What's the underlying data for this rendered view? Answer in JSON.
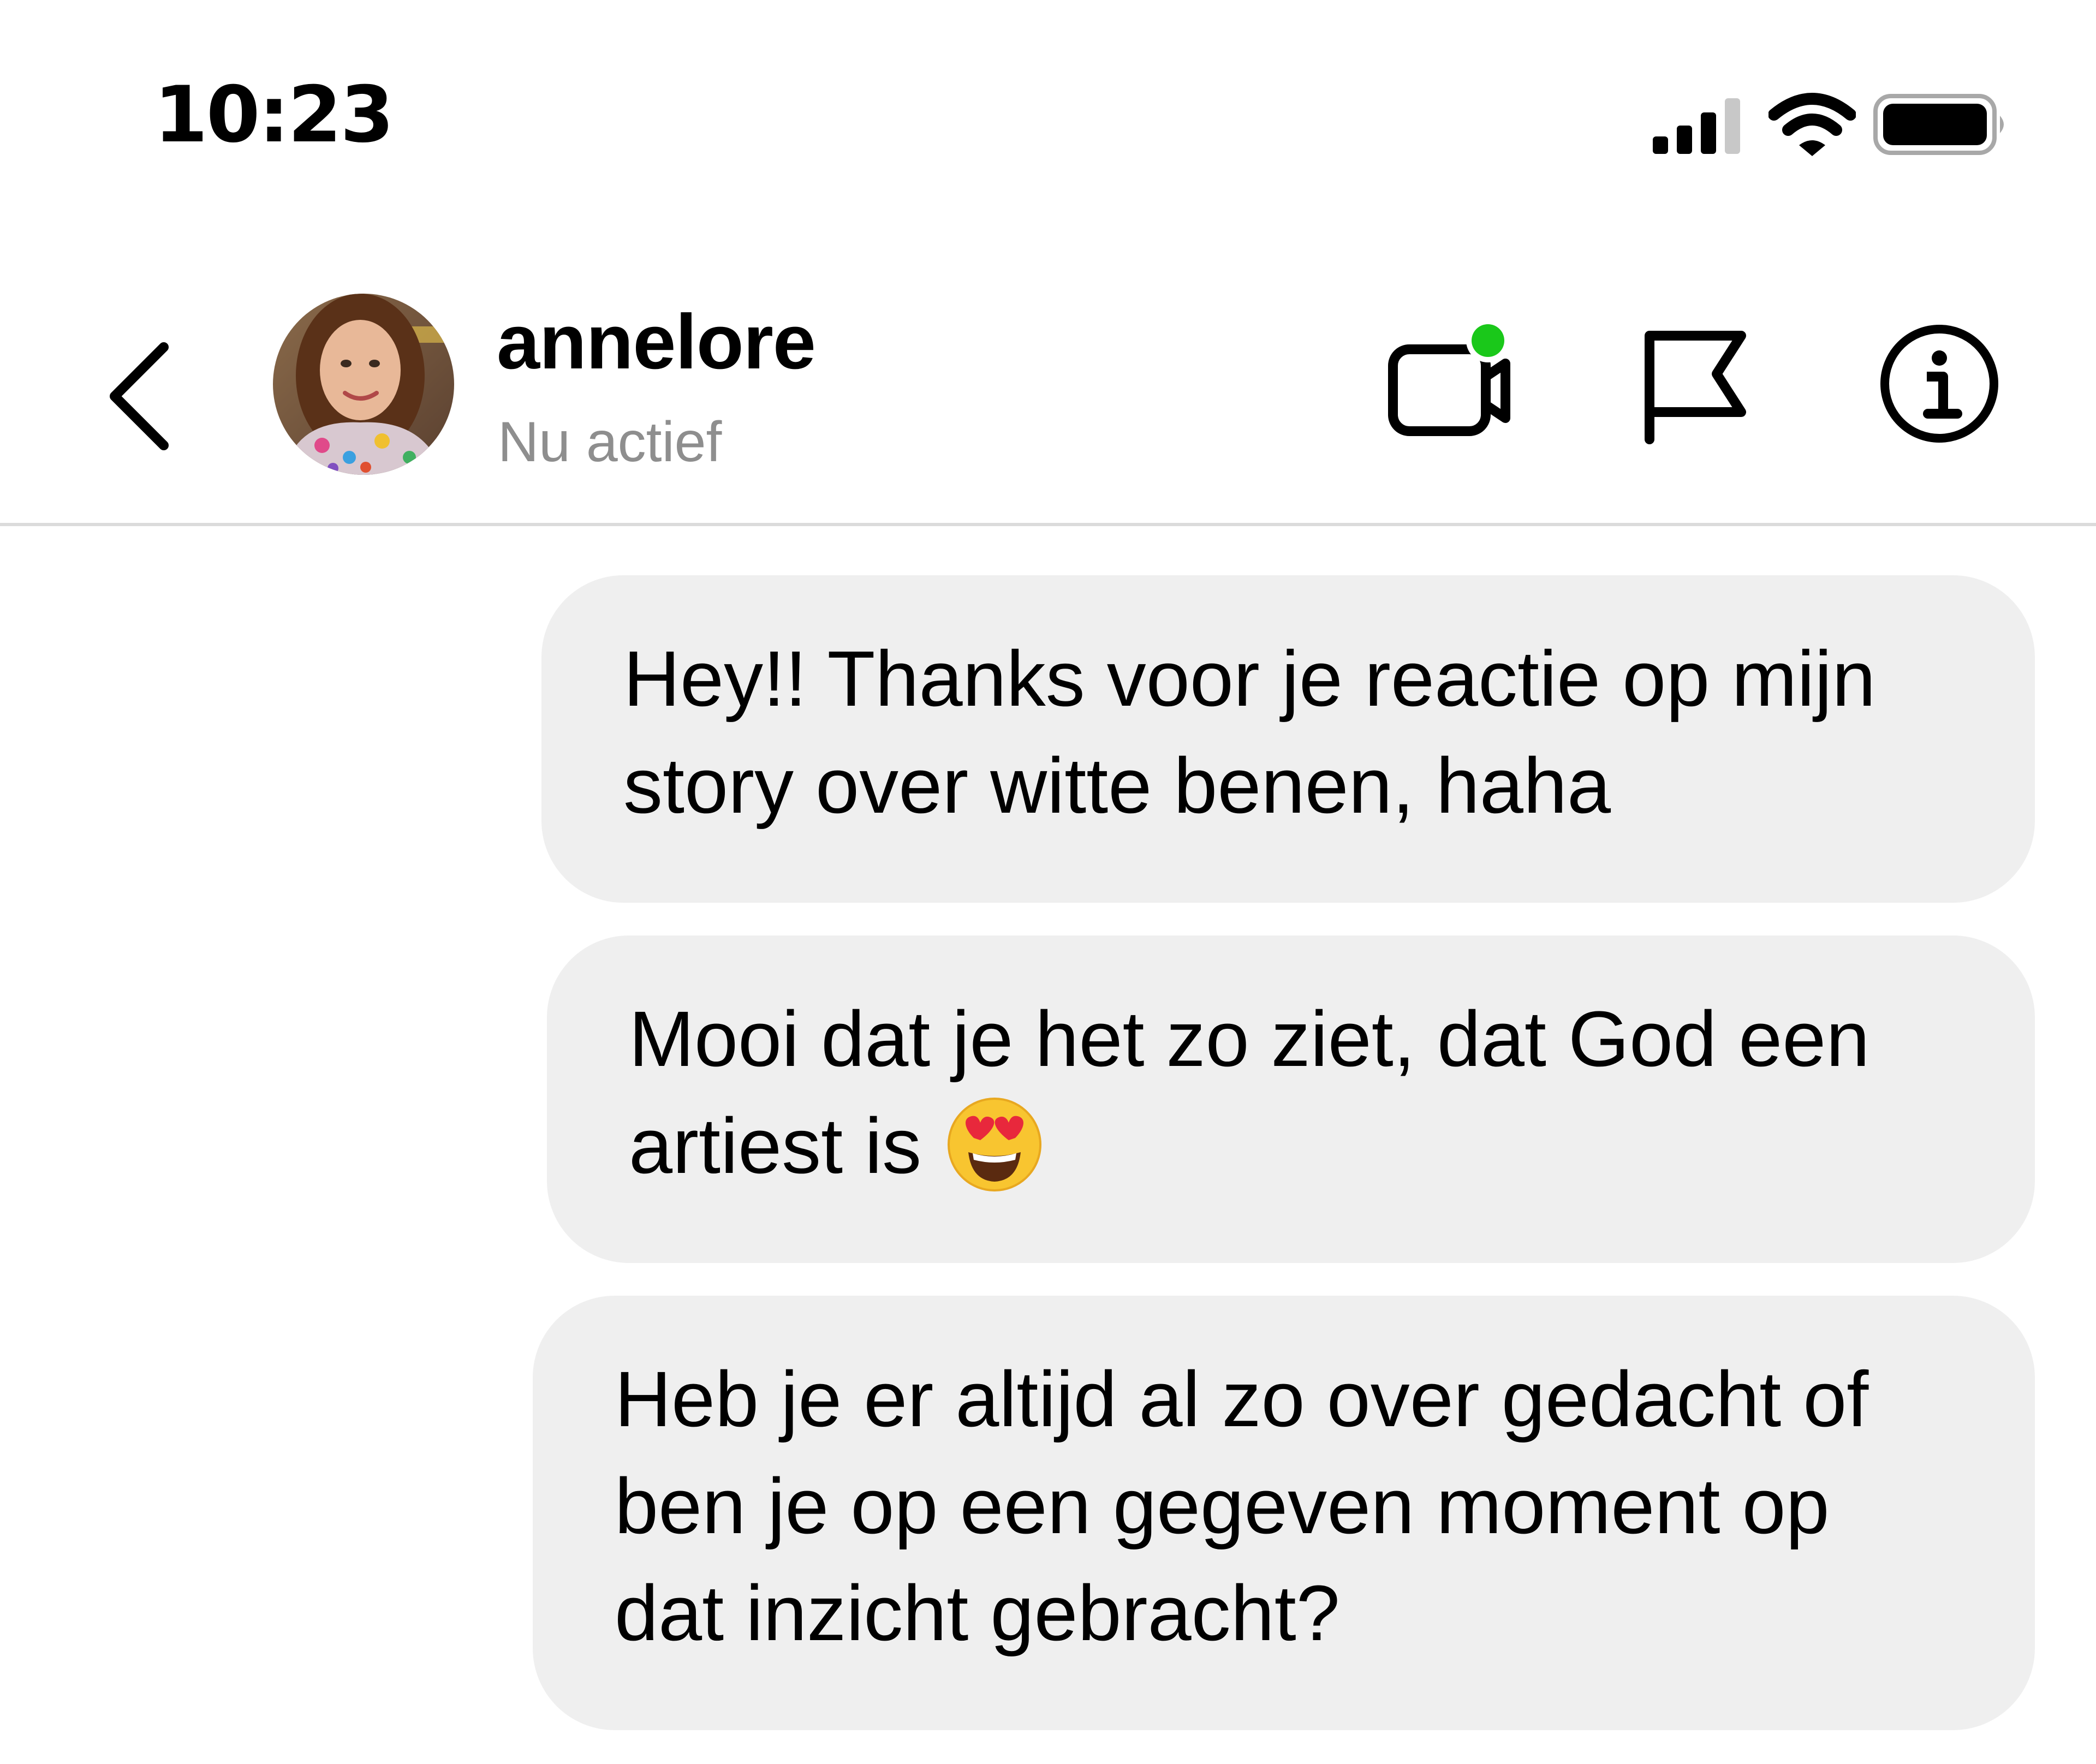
{
  "status_bar": {
    "time": "10:23",
    "icons": [
      "cellular-signal-icon",
      "wifi-icon",
      "battery-icon"
    ]
  },
  "header": {
    "back_icon": "chevron-left-icon",
    "username": "annelore",
    "presence": "Nu actief",
    "actions": [
      "video-call-icon",
      "flag-icon",
      "info-icon"
    ],
    "presence_dot_color": "#1ac81a"
  },
  "messages": [
    {
      "text": "Hey!! Thanks voor je reactie op mijn\nstory over witte benen, haha"
    },
    {
      "text": "Mooi dat je het zo ziet, dat God een\nartiest is",
      "emoji": "smiling-face-with-heart-eyes"
    },
    {
      "text": "Heb je er altijd al zo over gedacht of\nben je op een gegeven moment op\ndat inzicht gebracht?"
    }
  ],
  "colors": {
    "bubble_background": "#efefef",
    "secondary_text": "#8e8e8e",
    "divider": "#dbdbdb"
  }
}
